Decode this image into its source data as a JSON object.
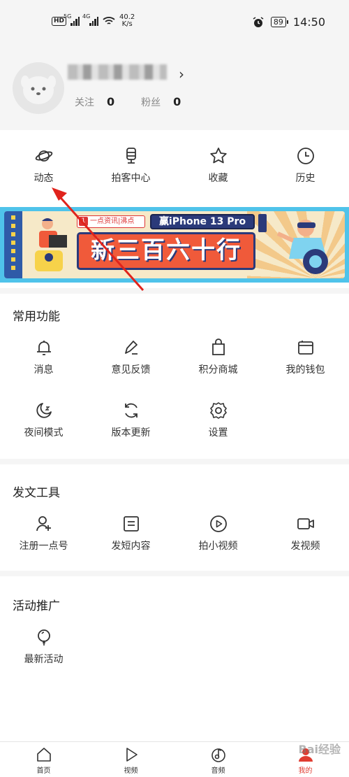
{
  "status_bar": {
    "network_badge": "HD",
    "sig1_label": "5G",
    "sig2_label": "4G",
    "speed": "40.2",
    "speed_unit": "K/s",
    "battery": "89",
    "time": "14:50"
  },
  "profile": {
    "follow_label": "关注",
    "follow_count": "0",
    "fans_label": "粉丝",
    "fans_count": "0"
  },
  "quick_nav": [
    {
      "label": "动态",
      "icon": "planet-icon"
    },
    {
      "label": "拍客中心",
      "icon": "microphone-icon"
    },
    {
      "label": "收藏",
      "icon": "star-icon"
    },
    {
      "label": "历史",
      "icon": "clock-icon"
    }
  ],
  "banner": {
    "tag": "一点资讯|沸点",
    "product": "赢iPhone 13 Pro",
    "headline": "新三百六十行"
  },
  "sections": {
    "common": {
      "title": "常用功能",
      "items": [
        {
          "label": "消息",
          "icon": "bell-icon"
        },
        {
          "label": "意见反馈",
          "icon": "pencil-icon"
        },
        {
          "label": "积分商城",
          "icon": "shopping-bag-icon"
        },
        {
          "label": "我的钱包",
          "icon": "wallet-icon"
        },
        {
          "label": "夜间模式",
          "icon": "moon-icon"
        },
        {
          "label": "版本更新",
          "icon": "refresh-icon"
        },
        {
          "label": "设置",
          "icon": "gear-icon"
        }
      ]
    },
    "tools": {
      "title": "发文工具",
      "items": [
        {
          "label": "注册一点号",
          "icon": "add-user-icon"
        },
        {
          "label": "发短内容",
          "icon": "document-icon"
        },
        {
          "label": "拍小视频",
          "icon": "play-circle-icon"
        },
        {
          "label": "发视频",
          "icon": "video-camera-icon"
        }
      ]
    },
    "promo": {
      "title": "活动推广",
      "items": [
        {
          "label": "最新活动",
          "icon": "balloon-icon"
        }
      ]
    }
  },
  "tab_bar": [
    {
      "label": "首页",
      "icon": "home-icon"
    },
    {
      "label": "视频",
      "icon": "play-icon"
    },
    {
      "label": "音频",
      "icon": "music-disc-icon"
    },
    {
      "label": "我的",
      "icon": "profile-icon",
      "active": true
    }
  ],
  "watermark": "Bai经验",
  "colors": {
    "accent": "#e03c31",
    "banner_bg": "#4fc3ea"
  }
}
